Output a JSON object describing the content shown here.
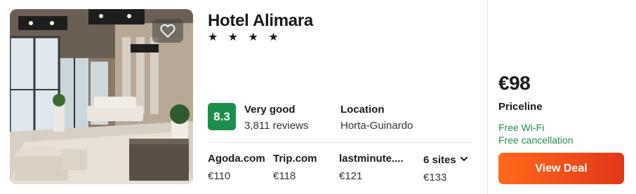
{
  "hotel": {
    "name": "Hotel Alimara",
    "stars_text": "★ ★ ★ ★",
    "star_rating": 4,
    "score": "8.3",
    "rating_label": "Very good",
    "reviews": "3,811 reviews",
    "location_label": "Location",
    "location_value": "Horta-Guinardo"
  },
  "offers": [
    {
      "site": "Agoda.com",
      "price": "€110"
    },
    {
      "site": "Trip.com",
      "price": "€118"
    },
    {
      "site": "lastminute....",
      "price": "€121"
    },
    {
      "site": "6 sites",
      "price": "€133"
    }
  ],
  "deal": {
    "price": "€98",
    "provider": "Priceline",
    "amenities": [
      "Free Wi-Fi",
      "Free cancellation"
    ],
    "button_label": "View Deal"
  },
  "icons": {
    "favorite": "heart-icon",
    "more_sites": "chevron-down-icon",
    "stars": "star-icon"
  },
  "colors": {
    "score_badge": "#1b8f4c",
    "amenity_text": "#1b8f4c",
    "deal_button_start": "#ff6a1a",
    "deal_button_end": "#e2381b"
  }
}
